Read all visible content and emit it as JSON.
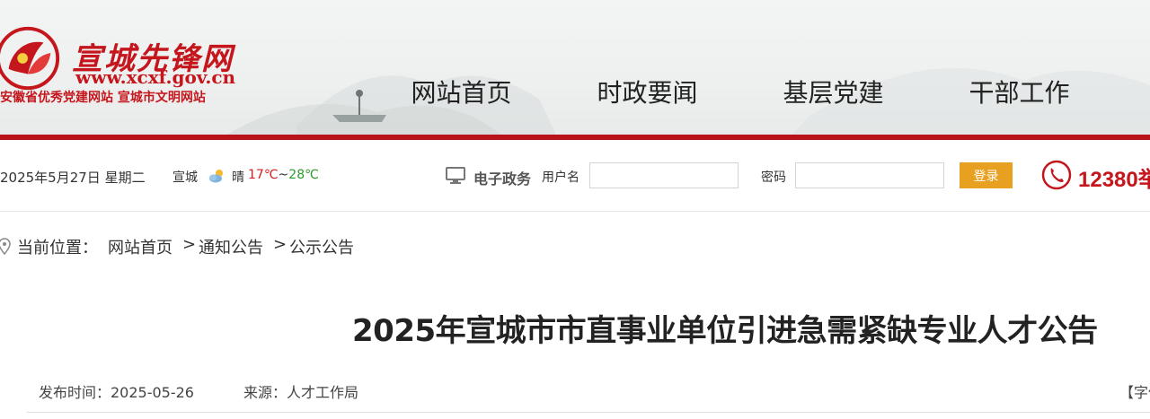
{
  "brand": {
    "site_name": "宣城先锋网",
    "url": "www.xcxf.gov.cn",
    "slogan": "安徽省优秀党建网站  宣城市文明网站",
    "primary_color": "#c4161c"
  },
  "nav": {
    "items": [
      {
        "label": "网站首页"
      },
      {
        "label": "时政要闻"
      },
      {
        "label": "基层党建"
      },
      {
        "label": "干部工作"
      }
    ]
  },
  "infobar": {
    "date": "2025年5月27日 星期二",
    "city": "宣城",
    "weather_icon": "partly-cloudy-icon",
    "condition": "晴",
    "temp_low": "17℃",
    "temp_sep": "~",
    "temp_high": "28℃",
    "egov_label": "电子政务",
    "username_label": "用户名",
    "username_value": "",
    "password_label": "密码",
    "password_value": "",
    "login_label": "登录",
    "hotline": "12380举"
  },
  "breadcrumb": {
    "label": "当前位置：",
    "items": [
      "网站首页",
      "通知公告",
      "公示公告"
    ],
    "separator": ">"
  },
  "article": {
    "title": "2025年宣城市市直事业单位引进急需紧缺专业人才公告",
    "publish": "发布时间：2025-05-26",
    "source": "来源：人才工作局",
    "font_control": "【字体"
  }
}
